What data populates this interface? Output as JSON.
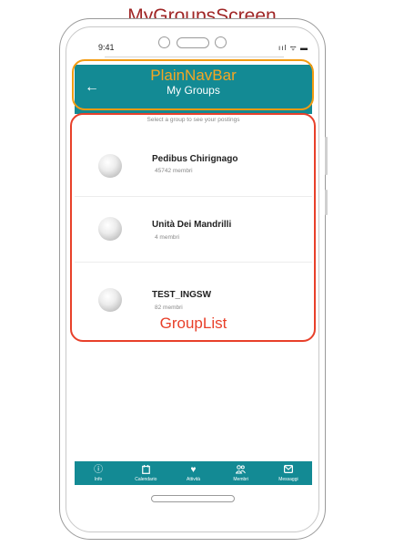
{
  "annotations": {
    "screen_name": "MyGroupsScreen",
    "navbar_component": "PlainNavBar",
    "list_component": "GroupList"
  },
  "status_bar": {
    "time": "9:41",
    "icons": "ııl ᯤ ▬"
  },
  "navbar": {
    "back_icon": "arrow-left-icon",
    "back_glyph": "←",
    "title": "My Groups"
  },
  "hint": "Select a group to see your postings",
  "groups": [
    {
      "name": "Pedibus Chirignago",
      "members": "45742 membri"
    },
    {
      "name": "Unità Dei Mandrilli",
      "members": "4 membri"
    },
    {
      "name": "TEST_INGSW",
      "members": "82 membri"
    }
  ],
  "tabbar": {
    "color": "#138a94",
    "tabs": [
      {
        "label": "Info",
        "icon": "info-icon",
        "glyph": "ⓘ"
      },
      {
        "label": "Calendario",
        "icon": "calendar-icon",
        "glyph": "🗓"
      },
      {
        "label": "Attività",
        "icon": "heart-icon",
        "glyph": "♥"
      },
      {
        "label": "Membri",
        "icon": "members-icon",
        "glyph": "👥"
      },
      {
        "label": "Messaggi",
        "icon": "mail-icon",
        "glyph": "✉"
      }
    ]
  }
}
